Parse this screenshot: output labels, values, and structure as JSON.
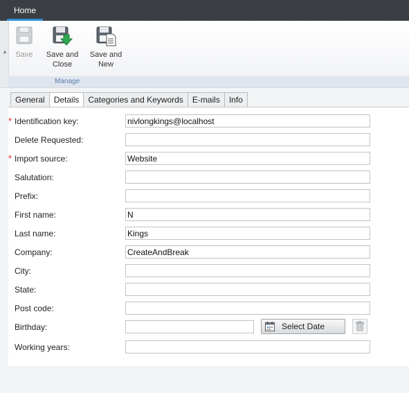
{
  "header": {
    "home_tab": "Home"
  },
  "ribbon": {
    "save_label": "Save",
    "save_close_label_1": "Save and",
    "save_close_label_2": "Close",
    "save_new_label_1": "Save and",
    "save_new_label_2": "New",
    "group_label": "Manage"
  },
  "tabs": [
    "General",
    "Details",
    "Categories and Keywords",
    "E-mails",
    "Info"
  ],
  "form": {
    "identification_key": {
      "label": "Identification key:",
      "value": "nivlongkings@localhost"
    },
    "delete_requested": {
      "label": "Delete Requested:",
      "value": ""
    },
    "import_source": {
      "label": "Import source:",
      "value": "Website"
    },
    "salutation": {
      "label": "Salutation:",
      "value": ""
    },
    "prefix": {
      "label": "Prefix:",
      "value": ""
    },
    "first_name": {
      "label": "First name:",
      "value": "N"
    },
    "last_name": {
      "label": "Last name:",
      "value": "Kings"
    },
    "company": {
      "label": "Company:",
      "value": "CreateAndBreak"
    },
    "city": {
      "label": "City:",
      "value": ""
    },
    "state": {
      "label": "State:",
      "value": ""
    },
    "post_code": {
      "label": "Post code:",
      "value": ""
    },
    "birthday": {
      "label": "Birthday:",
      "value": "",
      "button": "Select Date"
    },
    "working_years": {
      "label": "Working years:",
      "value": ""
    }
  },
  "colors": {
    "required": "#dd2222",
    "accent": "#2f8fd8",
    "topbar": "#3a3d42"
  }
}
